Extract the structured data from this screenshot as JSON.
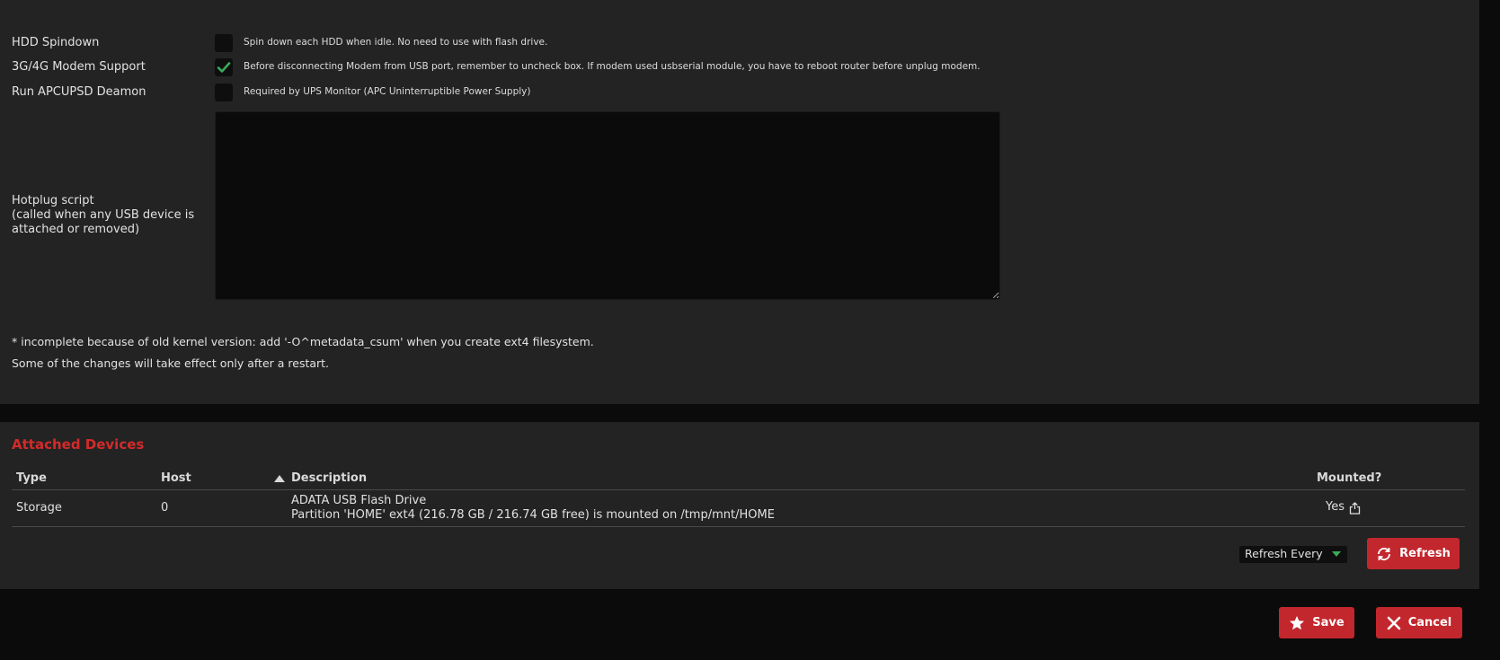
{
  "settings": {
    "hdd_spindown": {
      "label": "HDD Spindown",
      "checked": false,
      "hint": "Spin down each HDD when idle. No need to use with flash drive."
    },
    "modem_support": {
      "label": "3G/4G Modem Support",
      "checked": true,
      "hint": "Before disconnecting Modem from USB port, remember to uncheck box. If modem used usbserial module, you have to reboot router before unplug modem."
    },
    "apcupsd": {
      "label": "Run APCUPSD Deamon",
      "checked": false,
      "hint": "Required by UPS Monitor (APC Uninterruptible Power Supply)"
    },
    "hotplug": {
      "label_line1": "Hotplug script",
      "label_line2": "(called when any USB device is",
      "label_line3": "attached or removed)",
      "value": ""
    }
  },
  "notes": {
    "kernel": "* incomplete because of old kernel version: add '-O^metadata_csum' when you create ext4 filesystem.",
    "restart": "Some of the changes will take effect only after a restart."
  },
  "attached_devices": {
    "title": "Attached Devices",
    "columns": [
      "Type",
      "Host",
      "Description",
      "Mounted?"
    ],
    "rows": [
      {
        "type": "Storage",
        "host": "0",
        "description_line1": "ADATA USB Flash Drive",
        "description_line2": "Partition 'HOME' ext4 (216.78 GB / 216.74 GB free) is mounted on /tmp/mnt/HOME",
        "mounted": "Yes"
      }
    ],
    "refresh_select": "Refresh Every",
    "refresh_button": "Refresh"
  },
  "footer": {
    "save": "Save",
    "cancel": "Cancel"
  },
  "colors": {
    "accent_red": "#c2272d",
    "title_red": "#d42a2a",
    "check_green": "#3aaa5a"
  }
}
